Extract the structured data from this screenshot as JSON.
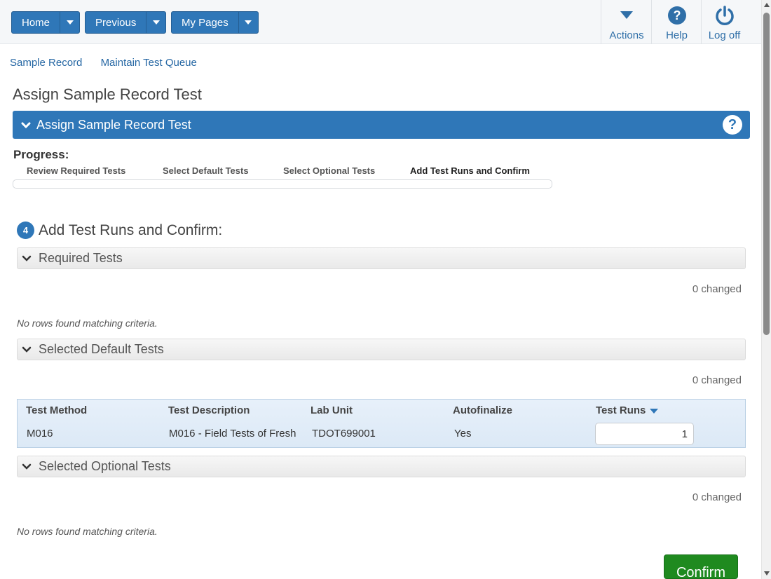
{
  "nav": {
    "home": "Home",
    "previous": "Previous",
    "my_pages": "My Pages"
  },
  "toolbar": {
    "actions": "Actions",
    "help": "Help",
    "logoff": "Log off"
  },
  "breadcrumb": [
    "Sample Record",
    "Maintain Test Queue"
  ],
  "page_title": "Assign Sample Record Test",
  "panel_title": "Assign Sample Record Test",
  "progress": {
    "label": "Progress:",
    "steps": [
      "Review Required Tests",
      "Select Default Tests",
      "Select Optional Tests",
      "Add Test Runs and Confirm"
    ],
    "current_step": 4
  },
  "step": {
    "number": "4",
    "title": "Add Test Runs and Confirm:"
  },
  "sections": {
    "required": {
      "title": "Required Tests",
      "changed": "0 changed",
      "empty": "No rows found matching criteria."
    },
    "default": {
      "title": "Selected Default Tests",
      "changed": "0 changed"
    },
    "optional": {
      "title": "Selected Optional Tests",
      "changed": "0 changed",
      "empty": "No rows found matching criteria."
    }
  },
  "grid": {
    "columns": [
      "Test Method",
      "Test Description",
      "Lab Unit",
      "Autofinalize",
      "Test Runs"
    ],
    "rows": [
      {
        "test_method": "M016",
        "test_description": "M016 - Field Tests of Fresh",
        "lab_unit": "TDOT699001",
        "autofinalize": "Yes",
        "test_runs": "1"
      }
    ]
  },
  "confirm_label": "Confirm",
  "colors": {
    "primary": "#2f77b8",
    "confirm": "#1f8a1f",
    "link": "#2466a3"
  }
}
